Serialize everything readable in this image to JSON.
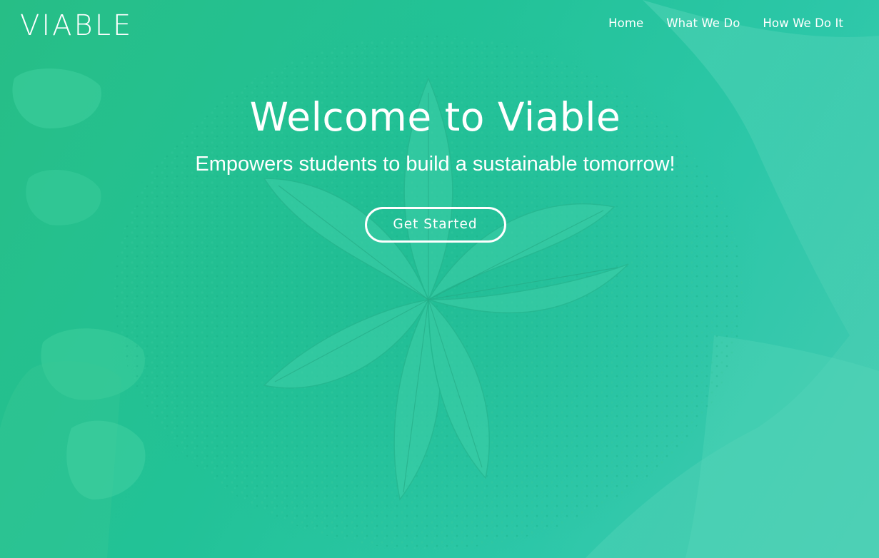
{
  "nav": {
    "brand": "VIABLE",
    "links": [
      {
        "label": "Home"
      },
      {
        "label": "What We Do"
      },
      {
        "label": "How We Do It"
      }
    ]
  },
  "hero": {
    "title": "Welcome to Viable",
    "subtitle": "Empowers students to build a sustainable tomorrow!",
    "cta_label": "Get Started",
    "background_image": "hands-holding-soil-seedling",
    "overlay_colors": [
      "#27be86",
      "#22c297",
      "#2cc7a8",
      "#45cbb2"
    ]
  }
}
